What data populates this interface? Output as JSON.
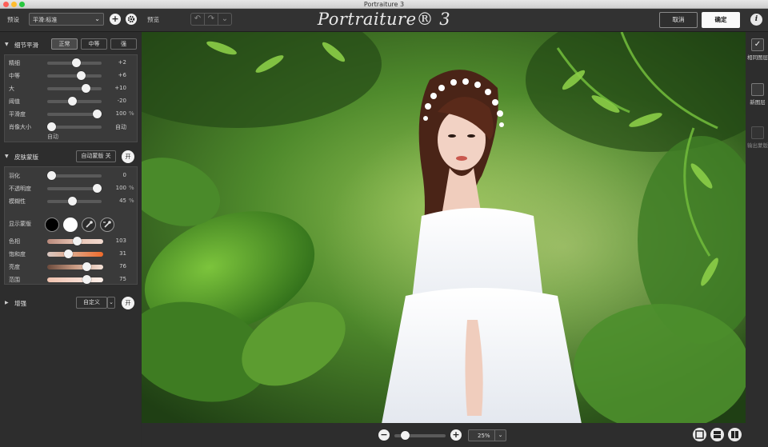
{
  "window": {
    "title": "Portraiture 3"
  },
  "topbar": {
    "preset_label": "预设",
    "preset_value": "平滑:标准",
    "preview_label": "预览",
    "logo": "Portraiture® 3",
    "cancel": "取消",
    "ok": "确定",
    "info": "i"
  },
  "detail": {
    "title": "细节平滑",
    "modes": [
      "正常",
      "中等",
      "强"
    ],
    "active_mode": "正常",
    "sliders": [
      {
        "label": "精细",
        "value": "+2",
        "unit": "",
        "level": 0.55
      },
      {
        "label": "中等",
        "value": "+6",
        "unit": "",
        "level": 0.65
      },
      {
        "label": "大",
        "value": "+10",
        "unit": "",
        "level": 0.75
      },
      {
        "label": "阈值",
        "value": "-20",
        "unit": "",
        "level": 0.45
      },
      {
        "label": "平滑度",
        "value": "100",
        "unit": "%",
        "level": 1.0
      },
      {
        "label": "肖像大小",
        "value": "自动",
        "unit": "",
        "level": 0.0
      }
    ],
    "auto_sub": "自动"
  },
  "skin": {
    "title": "皮肤蒙版",
    "auto_mask_btn": "自动蒙版 关",
    "toggle": "开",
    "sliders": [
      {
        "label": "羽化",
        "value": "0",
        "unit": "",
        "level": 0.0
      },
      {
        "label": "不透明度",
        "value": "100",
        "unit": "%",
        "level": 1.0
      },
      {
        "label": "模糊性",
        "value": "45",
        "unit": "%",
        "level": 0.45
      }
    ],
    "show_mask": "显示蒙版",
    "color_sliders": [
      {
        "label": "色相",
        "value": "103",
        "level": 0.55
      },
      {
        "label": "饱和度",
        "value": "31",
        "level": 0.35
      },
      {
        "label": "亮度",
        "value": "76",
        "level": 0.75
      },
      {
        "label": "范围",
        "value": "75",
        "level": 0.74
      }
    ]
  },
  "enhance": {
    "title": "增强",
    "preset": "自定义",
    "toggle": "开"
  },
  "rightbar": {
    "items": [
      {
        "label": "相同图层",
        "checked": true
      },
      {
        "label": "新图层",
        "checked": false
      },
      {
        "label": "输出蒙版",
        "checked": false
      }
    ]
  },
  "bottombar": {
    "zoom": "25%",
    "zoom_level": 0.15
  },
  "colors": {
    "accent_white": "#f2f2f2",
    "panel": "#3a3a3a",
    "background": "#2b2b2b"
  }
}
